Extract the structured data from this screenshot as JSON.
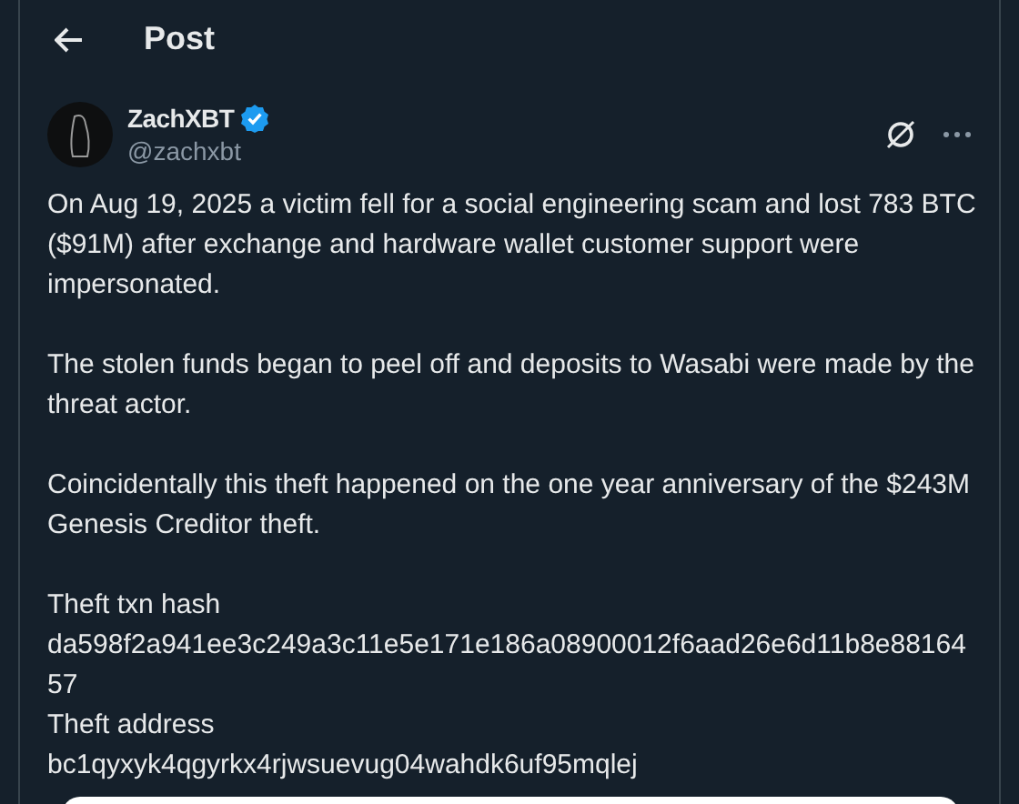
{
  "header": {
    "title": "Post"
  },
  "post": {
    "author": {
      "name": "ZachXBT",
      "verified": true,
      "handle": "@zachxbt"
    },
    "paragraphs": [
      [
        "On Aug 19, 2025 a victim fell for a social engineering scam and lost 783 BTC ($91M) after exchange and hardware wallet customer support were impersonated."
      ],
      [
        "The stolen funds began to peel off and deposits to Wasabi were made by the threat actor."
      ],
      [
        "Coincidentally this theft happened on the one year anniversary of the $243M Genesis Creditor theft."
      ],
      [
        "Theft txn hash",
        "da598f2a941ee3c249a3c11e5e171e186a08900012f6aad26e6d11b8e8816457",
        "Theft address",
        "bc1qyxyk4qgyrkx4rjwsuevug04wahdk6uf95mqlej"
      ]
    ]
  }
}
